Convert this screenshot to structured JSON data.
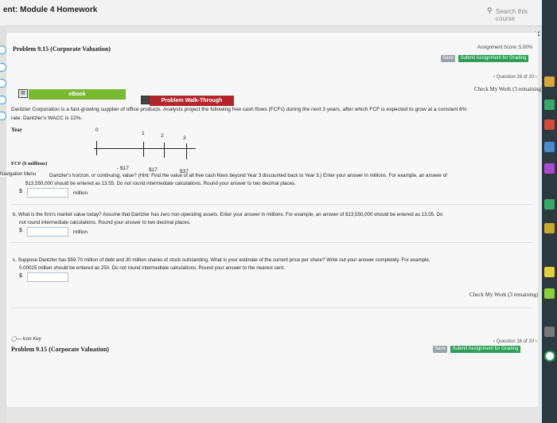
{
  "window": {
    "title": "ent: Module 4 Homework",
    "search_placeholder": "Search this course",
    "close_label": "×"
  },
  "header": {
    "problem_title": "Problem 9.15 (Corporate Valuation)",
    "assignment_score": "Assignment Score: 5.00%",
    "save_label": "Save",
    "submit_label": "Submit Assignment for Grading",
    "question_nav": "‹ Question 16 of 20 ›",
    "check_work": "Check My Work (3 remaining)"
  },
  "tools": {
    "ebook_label": "eBook",
    "walkthrough_label": "Problem Walk-Through"
  },
  "intro": {
    "line1": "Dantzler Corporation is a fast-growing supplier of office products. Analysts project the following free cash flows (FCFs) during the next 3 years, after which FCF is expected to grow at a constant 6%",
    "line2": "rate. Dantzler's WACC is 12%."
  },
  "timeline": {
    "year_label": "Year",
    "years": [
      "0",
      "1",
      "2",
      "3"
    ],
    "fcf_label": "FCF ($ millions)",
    "fcf_values": [
      "- $17",
      "$17",
      "$37"
    ]
  },
  "question_a": {
    "nav_overlay": "Navigation Menu",
    "line1": "Dantzler's horizon, or continuing, value? (Hint: Find the value of all free cash flows beyond Year 3 discounted back to Year 3.) Enter your answer in millions. For example, an answer of",
    "line2": "$13,550,000 should be entered as 13.55. Do not round intermediate calculations. Round your answer to two decimal places.",
    "currency": "$",
    "unit": "million"
  },
  "question_b": {
    "line1": "b. What is the firm's market value today? Assume that Dantzler has zero non-operating assets. Enter your answer in millions. For example, an answer of $13,550,000 should be entered as 13.55. Do",
    "line2": "not round intermediate calculations. Round your answer to two decimal places.",
    "currency": "$",
    "unit": "million"
  },
  "question_c": {
    "line1": "c. Suppose Dantzler has $59.70 million of debt and 30 million shares of stock outstanding. What is your estimate of the current price per share? Write out your answer completely. For example,",
    "line2": "0.00025 million should be entered as 250. Do not round intermediate calculations. Round your answer to the nearest cent.",
    "currency": "$"
  },
  "footer": {
    "check_work": "Check My Work (3 remaining)",
    "icon_key": "Icon Key",
    "question_nav": "‹ Question 16 of 20 ›",
    "problem_title": "Problem 9.15 (Corporate Valuation)",
    "save_label": "Save",
    "submit_label": "Submit Assignment for Grading"
  },
  "colors": {
    "ebook": "#79b934",
    "walkthrough": "#b2262b",
    "submit": "#2e9d57",
    "accent": "#3aa8c8"
  }
}
